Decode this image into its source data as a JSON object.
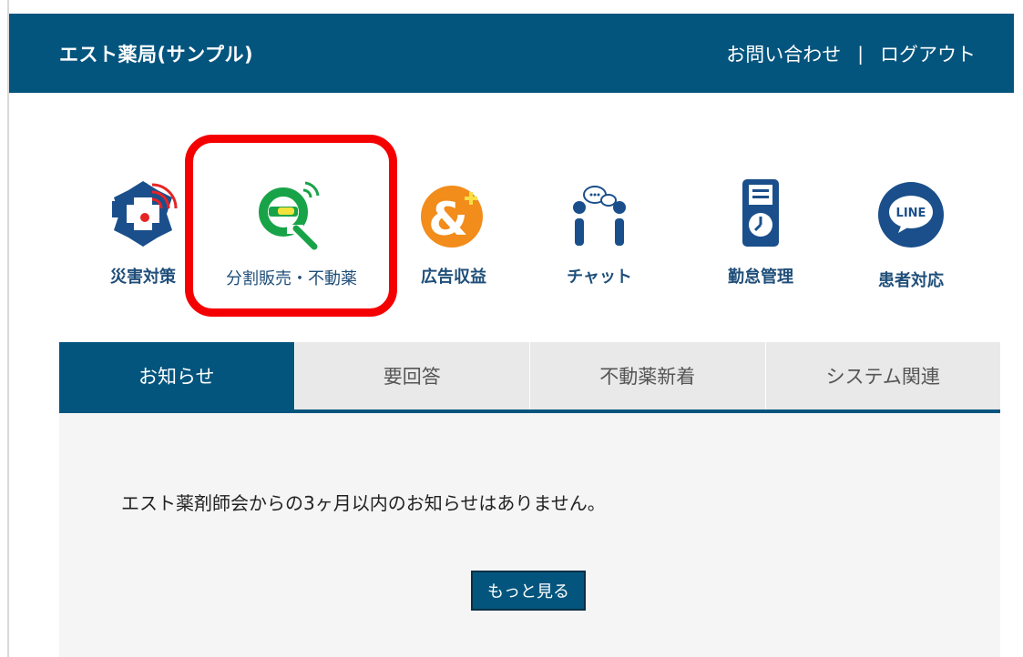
{
  "header": {
    "title": "エスト薬局(サンプル)",
    "contact_label": "お問い合わせ",
    "separator": "|",
    "logout_label": "ログアウト"
  },
  "menu": {
    "items": [
      {
        "label": "災害対策",
        "icon": "disaster-signal-icon"
      },
      {
        "label": "分割販売・不動薬",
        "icon": "e-magnifier-icon"
      },
      {
        "label": "広告収益",
        "icon": "ampersand-plus-icon"
      },
      {
        "label": "チャット",
        "icon": "chat-people-icon"
      },
      {
        "label": "勤怠管理",
        "icon": "timecard-clock-icon"
      },
      {
        "label": "患者対応",
        "icon": "line-bubble-icon",
        "icon_text": "LINE"
      }
    ]
  },
  "tabs": [
    {
      "label": "お知らせ",
      "active": true
    },
    {
      "label": "要回答",
      "active": false
    },
    {
      "label": "不動薬新着",
      "active": false
    },
    {
      "label": "システム関連",
      "active": false
    }
  ],
  "notice": {
    "message": "エスト薬剤師会からの3ヶ月以内のお知らせはありません。",
    "more_label": "もっと見る"
  },
  "colors": {
    "header_bg": "#04557e",
    "highlight": "#f40000",
    "green": "#19a348",
    "orange": "#f28c1a"
  }
}
